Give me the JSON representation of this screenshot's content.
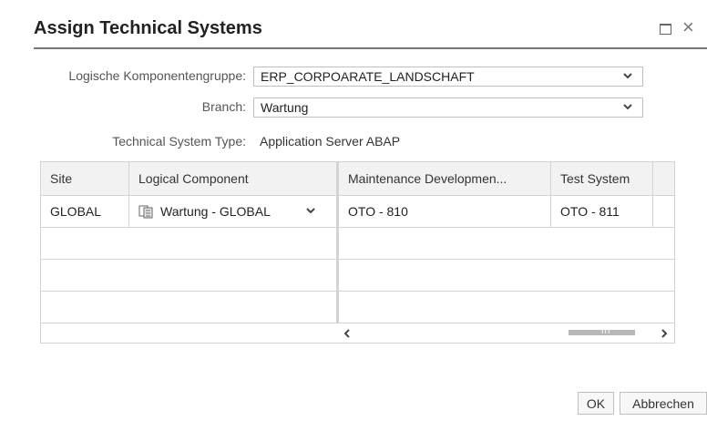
{
  "dialog": {
    "title": "Assign Technical Systems"
  },
  "form": {
    "component_group_label": "Logische Komponentengruppe:",
    "component_group_value": "ERP_CORPOARATE_LANDSCHAFT",
    "branch_label": "Branch:",
    "branch_value": "Wartung",
    "system_type_label": "Technical System Type:",
    "system_type_value": "Application Server ABAP"
  },
  "table": {
    "columns": [
      "Site",
      "Logical Component",
      "Maintenance Developmen...",
      "Test System"
    ],
    "rows": [
      {
        "site": "GLOBAL",
        "logical_component": "Wartung - GLOBAL",
        "maintenance_development": "OTO - 810",
        "test_system": "OTO - 811"
      }
    ]
  },
  "scrollbar": {
    "grip": "III"
  },
  "footer": {
    "ok_label": "OK",
    "cancel_label": "Abbrechen"
  },
  "icons": {
    "maximize": "maximize-icon",
    "close": "close-icon",
    "dropdown": "chevron-down-icon",
    "logical_component": "logical-component-icon",
    "scroll_left": "chevron-left-icon",
    "scroll_right": "chevron-right-icon"
  },
  "colors": {
    "header_rule": "#777777",
    "table_header_bg": "#f2f2f2",
    "grid_lines": "#d3d3d3"
  }
}
